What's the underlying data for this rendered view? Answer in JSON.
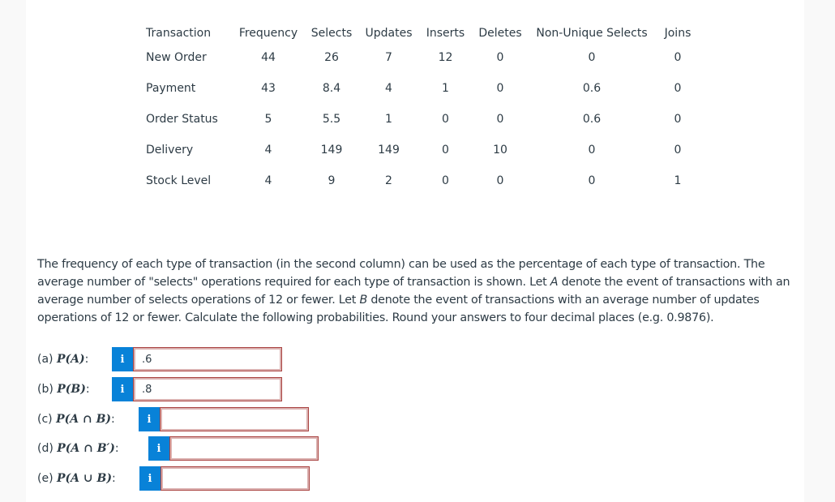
{
  "table": {
    "headers": [
      "Transaction",
      "Frequency",
      "Selects",
      "Updates",
      "Inserts",
      "Deletes",
      "Non-Unique Selects",
      "Joins"
    ],
    "rows": [
      [
        "New Order",
        "44",
        "26",
        "7",
        "12",
        "0",
        "0",
        "0"
      ],
      [
        "Payment",
        "43",
        "8.4",
        "4",
        "1",
        "0",
        "0.6",
        "0"
      ],
      [
        "Order Status",
        "5",
        "5.5",
        "1",
        "0",
        "0",
        "0.6",
        "0"
      ],
      [
        "Delivery",
        "4",
        "149",
        "149",
        "0",
        "10",
        "0",
        "0"
      ],
      [
        "Stock Level",
        "4",
        "9",
        "2",
        "0",
        "0",
        "0",
        "1"
      ]
    ]
  },
  "problem": {
    "part1": "The frequency of each type of transaction (in the second column) can be used as the percentage of each type of transaction. The average number of \"selects\" operations required for each type of transaction is shown. Let ",
    "varA": "A",
    "part2": " denote the event of transactions with an average number of selects operations of 12 or fewer. Let ",
    "varB": "B",
    "part3": " denote the event of transactions with an average number of updates operations of 12 or fewer. Calculate the following probabilities. Round your answers to four decimal places (e.g. 0.9876)."
  },
  "answers": [
    {
      "prefix": "(a) ",
      "expr": "P",
      "arg": "(A)",
      "suffix": ":",
      "value": ".6",
      "info_icon": "i"
    },
    {
      "prefix": "(b) ",
      "expr": "P",
      "arg": "(B)",
      "suffix": ":",
      "value": ".8",
      "info_icon": "i"
    },
    {
      "prefix": "(c) ",
      "expr": "P",
      "arg": "(A ∩ B)",
      "suffix": ":",
      "value": "",
      "info_icon": "i"
    },
    {
      "prefix": "(d) ",
      "expr": "P",
      "arg": "(A ∩ B′)",
      "suffix": ":",
      "value": "",
      "info_icon": "i"
    },
    {
      "prefix": "(e) ",
      "expr": "P",
      "arg": "(A ∪ B)",
      "suffix": ":",
      "value": "",
      "info_icon": "i"
    }
  ],
  "colors": {
    "info_button": "#0882d8",
    "input_error_border": "#a94442",
    "text": "#2d3b45"
  }
}
